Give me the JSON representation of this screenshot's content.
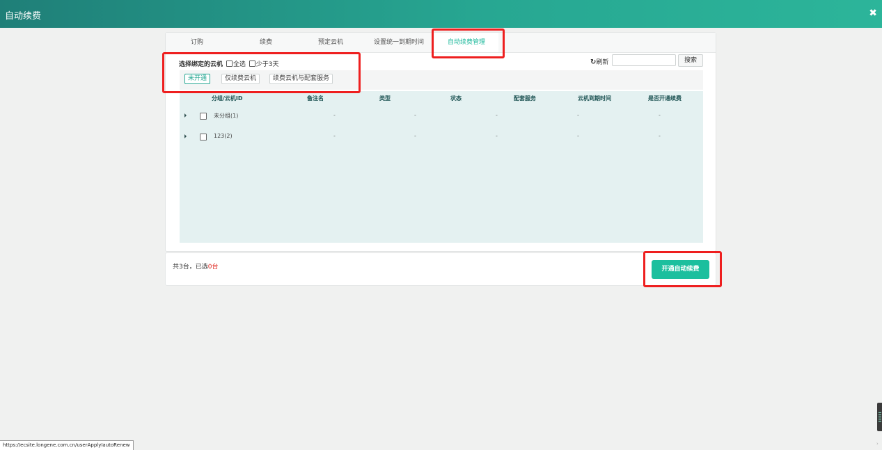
{
  "header": {
    "title": "自动续费",
    "close_icon": "close-icon"
  },
  "tabs": [
    {
      "label": "订购"
    },
    {
      "label": "续费"
    },
    {
      "label": "预定云机"
    },
    {
      "label": "设置统一到期时间"
    },
    {
      "label": "自动续费管理",
      "active": true
    }
  ],
  "selection": {
    "label": "选择绑定的云机",
    "select_all": "全选",
    "less_than_3_days": "少于3天"
  },
  "toolbar": {
    "refresh_label": "刷新",
    "refresh_icon": "refresh-icon",
    "search_placeholder": "",
    "search_button": "搜索"
  },
  "filters": [
    {
      "label": "未开通",
      "active": true
    },
    {
      "label": "仅续费云机"
    },
    {
      "label": "续费云机与配套服务"
    }
  ],
  "table": {
    "columns": [
      "分组/云机ID",
      "备注名",
      "类型",
      "状态",
      "配套服务",
      "云机到期时间",
      "是否开通续费"
    ],
    "rows": [
      {
        "name": "未分组(1)",
        "cells": [
          "-",
          "-",
          "-",
          "-",
          "-"
        ]
      },
      {
        "name": "123(2)",
        "cells": [
          "-",
          "-",
          "-",
          "-",
          "-"
        ]
      }
    ]
  },
  "footer": {
    "count_prefix": "共3台，已选",
    "selected_count": "0台",
    "enable_button": "开通自动续费"
  },
  "status_bar": {
    "url": "https://ecsite.longene.com.cn/userApplyIautoRenew"
  },
  "colors": {
    "accent": "#1cbf9e",
    "header_start": "#1f7f78",
    "highlight": "#ee1f1f",
    "table_bg": "#e4f1f1"
  }
}
